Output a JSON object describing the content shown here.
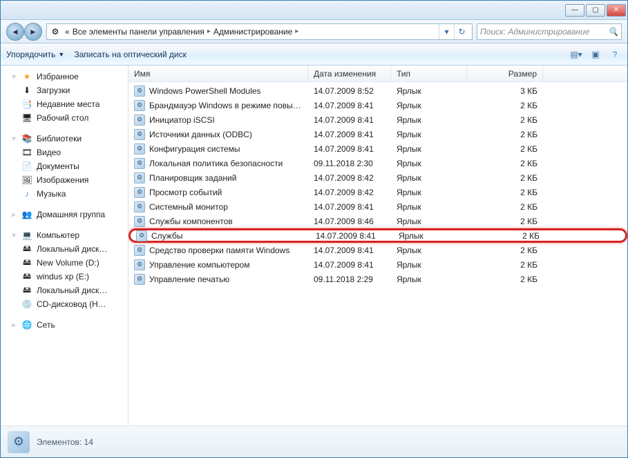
{
  "title": "",
  "breadcrumb": {
    "prefix": "«",
    "items": [
      "Все элементы панели управления",
      "Администрирование"
    ]
  },
  "search": {
    "placeholder": "Поиск: Администрирование"
  },
  "toolbar": {
    "organize": "Упорядочить",
    "burn": "Записать на оптический диск"
  },
  "nav": {
    "favorites": {
      "label": "Избранное",
      "items": [
        "Загрузки",
        "Недавние места",
        "Рабочий стол"
      ]
    },
    "libraries": {
      "label": "Библиотеки",
      "items": [
        "Видео",
        "Документы",
        "Изображения",
        "Музыка"
      ]
    },
    "homegroup": {
      "label": "Домашняя группа"
    },
    "computer": {
      "label": "Компьютер",
      "items": [
        "Локальный диск…",
        "New Volume (D:)",
        "windus xp (E:)",
        "Локальный диск…",
        "CD-дисковод (H…"
      ]
    },
    "network": {
      "label": "Сеть"
    }
  },
  "columns": {
    "name": "Имя",
    "date": "Дата изменения",
    "type": "Тип",
    "size": "Размер"
  },
  "items": [
    {
      "name": "Windows PowerShell Modules",
      "date": "14.07.2009 8:52",
      "type": "Ярлык",
      "size": "3 КБ"
    },
    {
      "name": "Брандмауэр Windows в режиме повы…",
      "date": "14.07.2009 8:41",
      "type": "Ярлык",
      "size": "2 КБ"
    },
    {
      "name": "Инициатор iSCSI",
      "date": "14.07.2009 8:41",
      "type": "Ярлык",
      "size": "2 КБ"
    },
    {
      "name": "Источники данных (ODBC)",
      "date": "14.07.2009 8:41",
      "type": "Ярлык",
      "size": "2 КБ"
    },
    {
      "name": "Конфигурация системы",
      "date": "14.07.2009 8:41",
      "type": "Ярлык",
      "size": "2 КБ"
    },
    {
      "name": "Локальная политика безопасности",
      "date": "09.11.2018 2:30",
      "type": "Ярлык",
      "size": "2 КБ"
    },
    {
      "name": "Планировщик заданий",
      "date": "14.07.2009 8:42",
      "type": "Ярлык",
      "size": "2 КБ"
    },
    {
      "name": "Просмотр событий",
      "date": "14.07.2009 8:42",
      "type": "Ярлык",
      "size": "2 КБ"
    },
    {
      "name": "Системный монитор",
      "date": "14.07.2009 8:41",
      "type": "Ярлык",
      "size": "2 КБ"
    },
    {
      "name": "Службы компонентов",
      "date": "14.07.2009 8:46",
      "type": "Ярлык",
      "size": "2 КБ"
    },
    {
      "name": "Службы",
      "date": "14.07.2009 8:41",
      "type": "Ярлык",
      "size": "2 КБ",
      "highlight": true
    },
    {
      "name": "Средство проверки памяти Windows",
      "date": "14.07.2009 8:41",
      "type": "Ярлык",
      "size": "2 КБ"
    },
    {
      "name": "Управление компьютером",
      "date": "14.07.2009 8:41",
      "type": "Ярлык",
      "size": "2 КБ"
    },
    {
      "name": "Управление печатью",
      "date": "09.11.2018 2:29",
      "type": "Ярлык",
      "size": "2 КБ"
    }
  ],
  "status": {
    "text": "Элементов: 14"
  }
}
